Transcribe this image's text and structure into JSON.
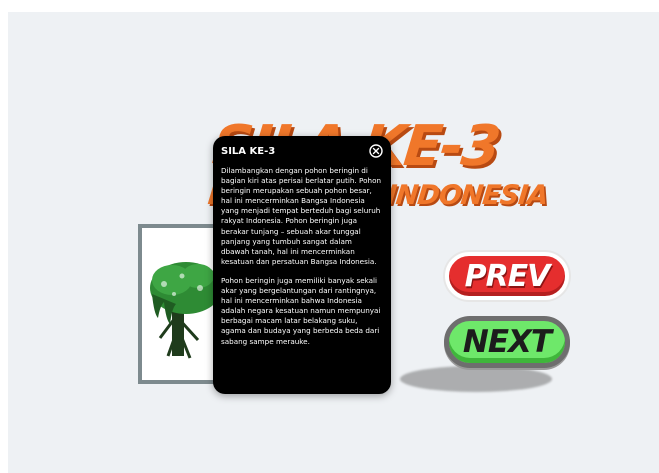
{
  "background": {
    "title": "SILA KE-3",
    "subtitle": "PERSATUAN INDONESIA"
  },
  "buttons": {
    "prev_label": "PREV",
    "next_label": "NEXT"
  },
  "modal": {
    "title": "SILA KE-3",
    "paragraphs": [
      "Dilambangkan dengan pohon beringin di bagian kiri atas perisai berlatar putih. Pohon beringin merupakan sebuah pohon besar, hal ini mencerminkan Bangsa Indonesia yang menjadi tempat berteduh bagi seluruh rakyat Indonesia. Pohon beringin juga berakar tunjang – sebuah akar tunggal panjang yang tumbuh sangat dalam dbawah tanah, hal ini mencerminkan kesatuan dan persatuan Bangsa Indonesia.",
      "Pohon beringin juga memiliki banyak sekali akar yang bergelantungan dari rantingnya, hal ini mencerminkan bahwa Indonesia adalah negara kesatuan namun mempunyai berbagai macam latar belakang suku, agama dan budaya yang berbeda beda dari sabang sampe merauke."
    ]
  },
  "icons": {
    "close": "close-circle-icon",
    "picture": "banyan-tree-icon"
  },
  "colors": {
    "prev": "#e52e2e",
    "next": "#6ee86a",
    "title": "#f0772a",
    "modal_bg": "#000000"
  }
}
